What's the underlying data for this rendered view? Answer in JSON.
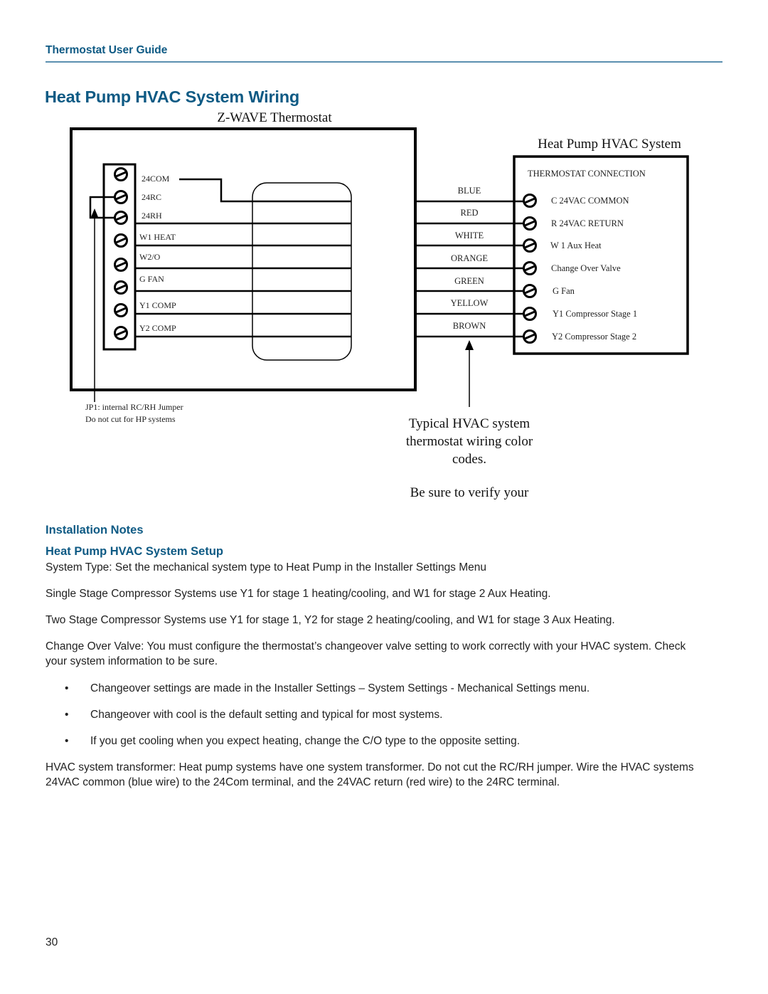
{
  "header": {
    "title": "Thermostat User Guide"
  },
  "page_title": "Heat Pump HVAC System Wiring",
  "diagram": {
    "thermostat_title": "Z-WAVE Thermostat",
    "thermostat_terminals": [
      "24COM",
      "24RC",
      "24RH",
      "W1 HEAT",
      "W2/O",
      "G  FAN",
      "Y1 COMP",
      "Y2 COMP"
    ],
    "wire_colors": [
      "BLUE",
      "RED",
      "WHITE",
      "ORANGE",
      "GREEN",
      "YELLOW",
      "BROWN"
    ],
    "hvac_title": "Heat Pump HVAC System",
    "hvac_subtitle": "THERMOSTAT CONNECTION",
    "hvac_terminals": [
      "C   24VAC COMMON",
      "R   24VAC  RETURN",
      "W 1 Aux Heat",
      "Change Over Valve",
      "G   Fan",
      "Y1 Compressor Stage 1",
      "Y2 Compressor Stage 2"
    ],
    "jumper_note": [
      "JP1: internal RC/RH Jumper",
      "Do not cut for HP systems"
    ],
    "color_caption": [
      "Typical HVAC system",
      "thermostat wiring color",
      "codes."
    ],
    "verify_caption": "Be sure to verify your"
  },
  "notes": {
    "heading": "Installation Notes",
    "subheading": "Heat Pump HVAC System Setup",
    "system_type": "System Type:  Set the mechanical system type to Heat Pump in the Installer Settings Menu",
    "single_stage": "Single Stage Compressor Systems use Y1 for stage 1 heating/cooling, and W1 for stage 2 Aux Heating.",
    "two_stage": "Two Stage Compressor Systems use Y1 for stage 1, Y2 for stage 2 heating/cooling, and W1 for stage 3 Aux Heating.",
    "change_over": "Change Over Valve: You must configure the thermostat’s changeover valve setting to work correctly with your HVAC system. Check your system information to be sure.",
    "bullets": [
      "Changeover settings are made in the Installer Settings – System Settings - Mechanical Settings menu.",
      "Changeover with cool is the default setting and typical for most systems.",
      "If you get cooling when you expect heating, change the C/O type to the opposite setting."
    ],
    "transformer": "HVAC system transformer:  Heat pump systems have one system transformer.  Do not cut the RC/RH jumper. Wire the HVAC systems 24VAC common (blue wire) to the 24Com terminal, and the 24VAC return (red wire) to the 24RC terminal."
  },
  "page_number": "30"
}
